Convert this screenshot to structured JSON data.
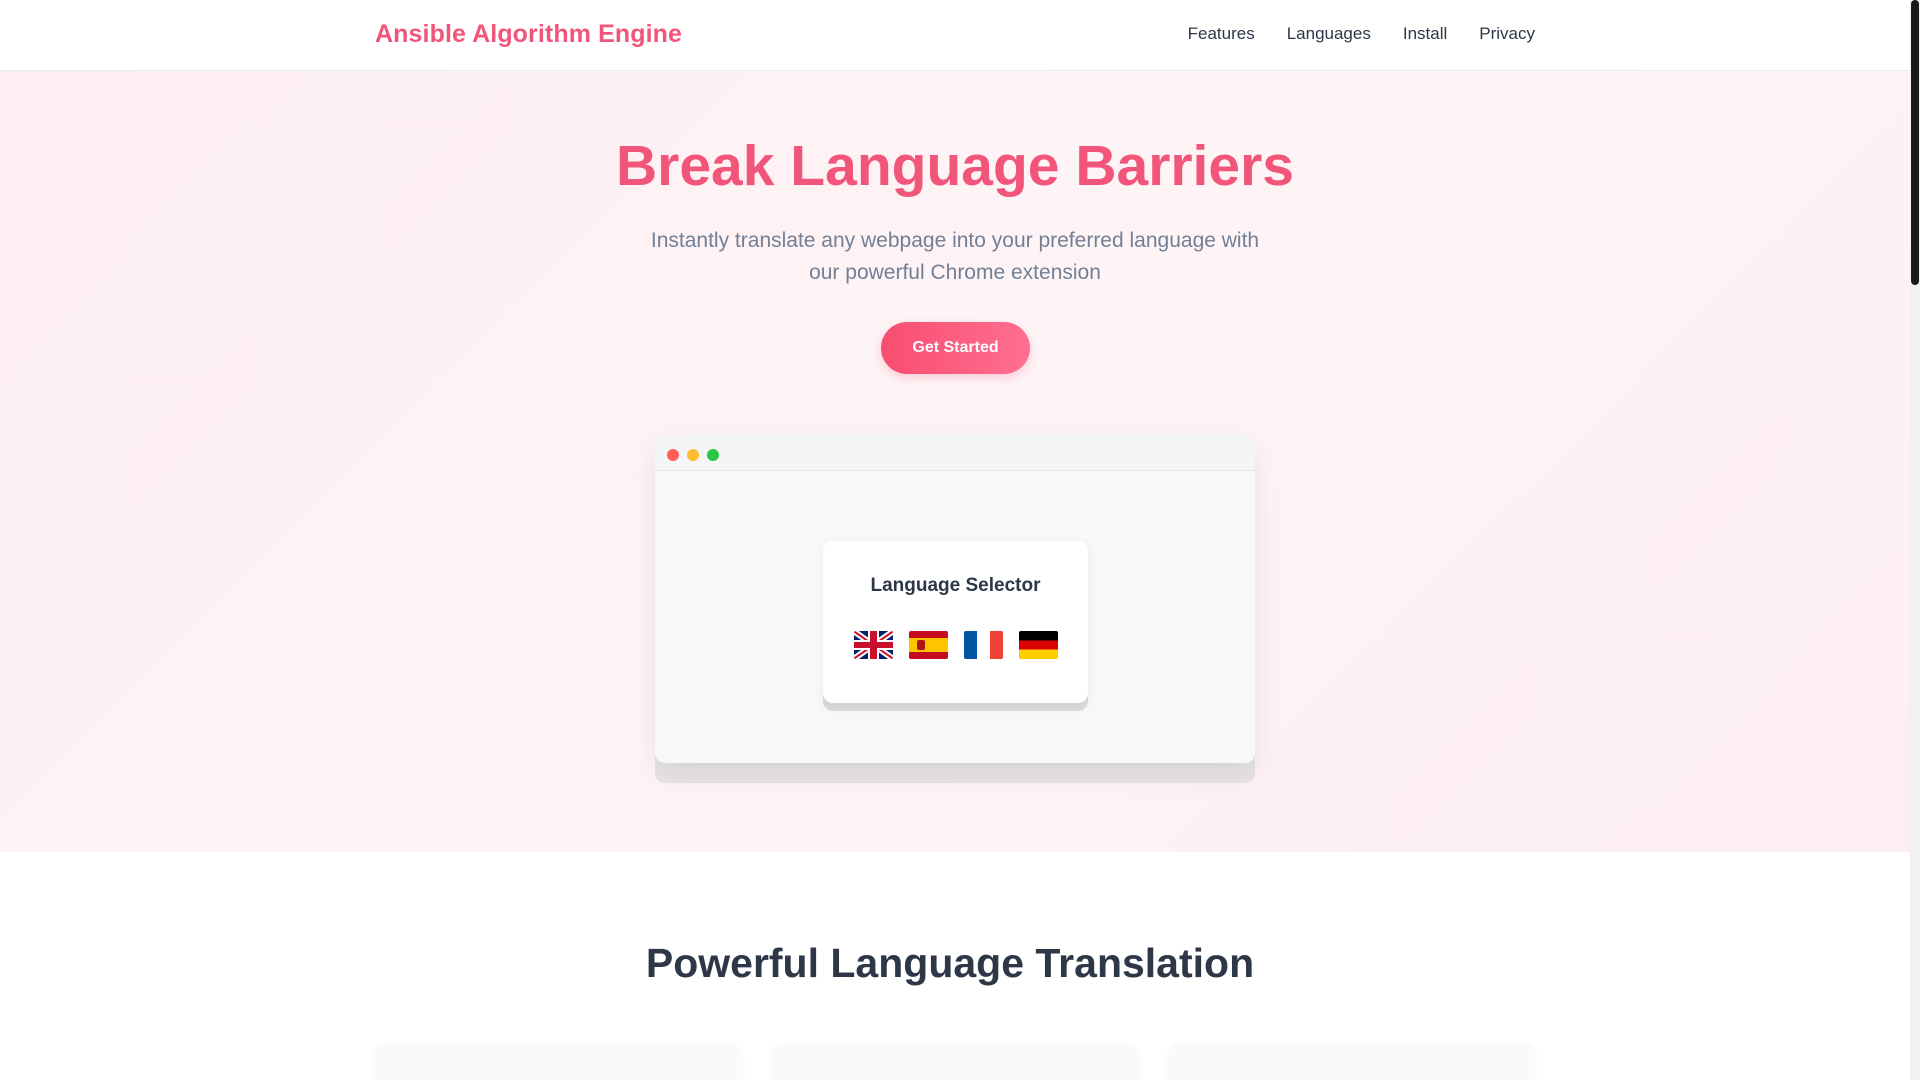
{
  "header": {
    "logo": "Ansible Algorithm Engine",
    "nav": [
      "Features",
      "Languages",
      "Install",
      "Privacy"
    ]
  },
  "hero": {
    "title": "Break Language Barriers",
    "subtitle_line1": "Instantly translate any webpage into your preferred language with",
    "subtitle_line2": "our powerful Chrome extension",
    "cta_label": "Get Started"
  },
  "mockup": {
    "card_title": "Language Selector",
    "flags": [
      "uk-flag-icon",
      "spain-flag-icon",
      "france-flag-icon",
      "germany-flag-icon"
    ]
  },
  "features": {
    "title": "Powerful Language Translation"
  },
  "colors": {
    "brand": "#f2557a",
    "text": "#2d3748",
    "muted": "#718096"
  }
}
